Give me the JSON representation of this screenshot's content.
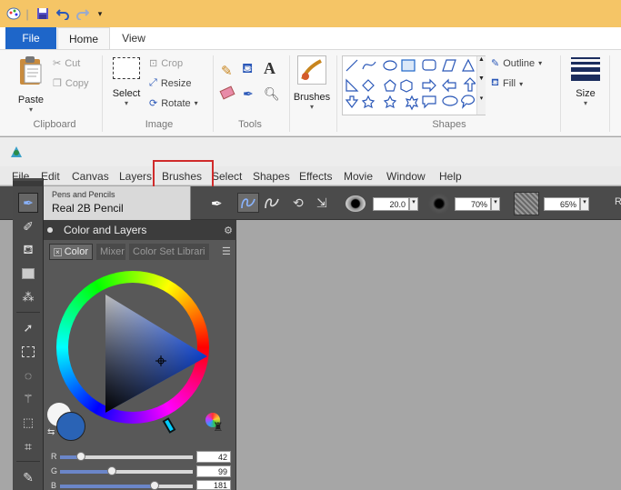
{
  "paint": {
    "tabs": {
      "file": "File",
      "home": "Home",
      "view": "View"
    },
    "clipboard": {
      "paste": "Paste",
      "cut": "Cut",
      "copy": "Copy",
      "label": "Clipboard"
    },
    "image": {
      "select": "Select",
      "crop": "Crop",
      "resize": "Resize",
      "rotate": "Rotate",
      "label": "Image"
    },
    "tools": {
      "label": "Tools"
    },
    "brushes": {
      "label": "Brushes"
    },
    "shapes": {
      "outline": "Outline",
      "fill": "Fill",
      "label": "Shapes"
    },
    "size": {
      "label": "Size"
    }
  },
  "painter": {
    "menu": [
      "File",
      "Edit",
      "Canvas",
      "Layers",
      "Brushes",
      "Select",
      "Shapes",
      "Effects",
      "Movie",
      "Window",
      "Help"
    ],
    "highlighted_menu": "Brushes",
    "brush_category": "Pens and Pencils",
    "brush_variant": "Real 2B Pencil",
    "size_value": "20.0",
    "opacity_value": "70%",
    "grain_value": "65%",
    "prop_trunc": "Ra",
    "panel": {
      "title": "Color and Layers",
      "tabs": {
        "color": "Color",
        "mixer": "Mixer",
        "color_sets": "Color Set Librari"
      },
      "rgb": {
        "r_label": "R",
        "r": "42",
        "g_label": "G",
        "g": "99",
        "b_label": "B",
        "b": "181"
      },
      "r_fraction": 0.16,
      "g_fraction": 0.39,
      "b_fraction": 0.71
    },
    "current_color": "#2a63b5",
    "highlight_color": "#d02b2b"
  }
}
